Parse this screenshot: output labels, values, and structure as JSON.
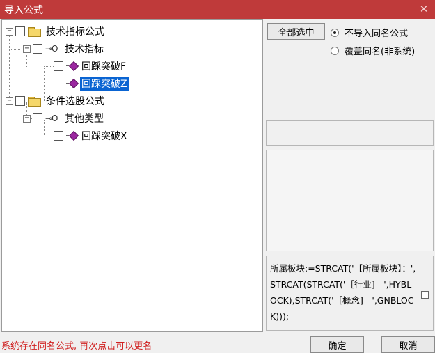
{
  "window": {
    "title": "导入公式",
    "close_glyph": "✕"
  },
  "tree": {
    "nodes": [
      {
        "label": "技术指标公式",
        "type": "folder",
        "expander": "−"
      },
      {
        "label": "技术指标",
        "type": "group",
        "expander": "−"
      },
      {
        "label": "回踩突破F",
        "type": "formula"
      },
      {
        "label": "回踩突破Z",
        "type": "formula",
        "selected": true
      },
      {
        "label": "条件选股公式",
        "type": "folder",
        "expander": "−"
      },
      {
        "label": "其他类型",
        "type": "group",
        "expander": "−"
      },
      {
        "label": "回踩突破X",
        "type": "formula"
      }
    ],
    "group_icon_glyph": "⊸O"
  },
  "options": {
    "select_all_label": "全部选中",
    "radio_no_import": "不导入同名公式",
    "radio_overwrite": "覆盖同名(非系统)",
    "selected_radio": "no_import"
  },
  "formula_preview": "所属板块:=STRCAT('【所属板块】：',STRCAT(STRCAT('［行业]—',HYBLOCK),STRCAT('［概念]—',GNBLOCK)));",
  "status_message": "系统存在同名公式, 再次点击可以更名",
  "buttons": {
    "ok_label": "确定",
    "cancel_label": "取消"
  },
  "colors": {
    "titlebar": "#bf3a3a",
    "selection": "#0a64d2",
    "status_text": "#d02020",
    "gem": "#9b27a0"
  }
}
